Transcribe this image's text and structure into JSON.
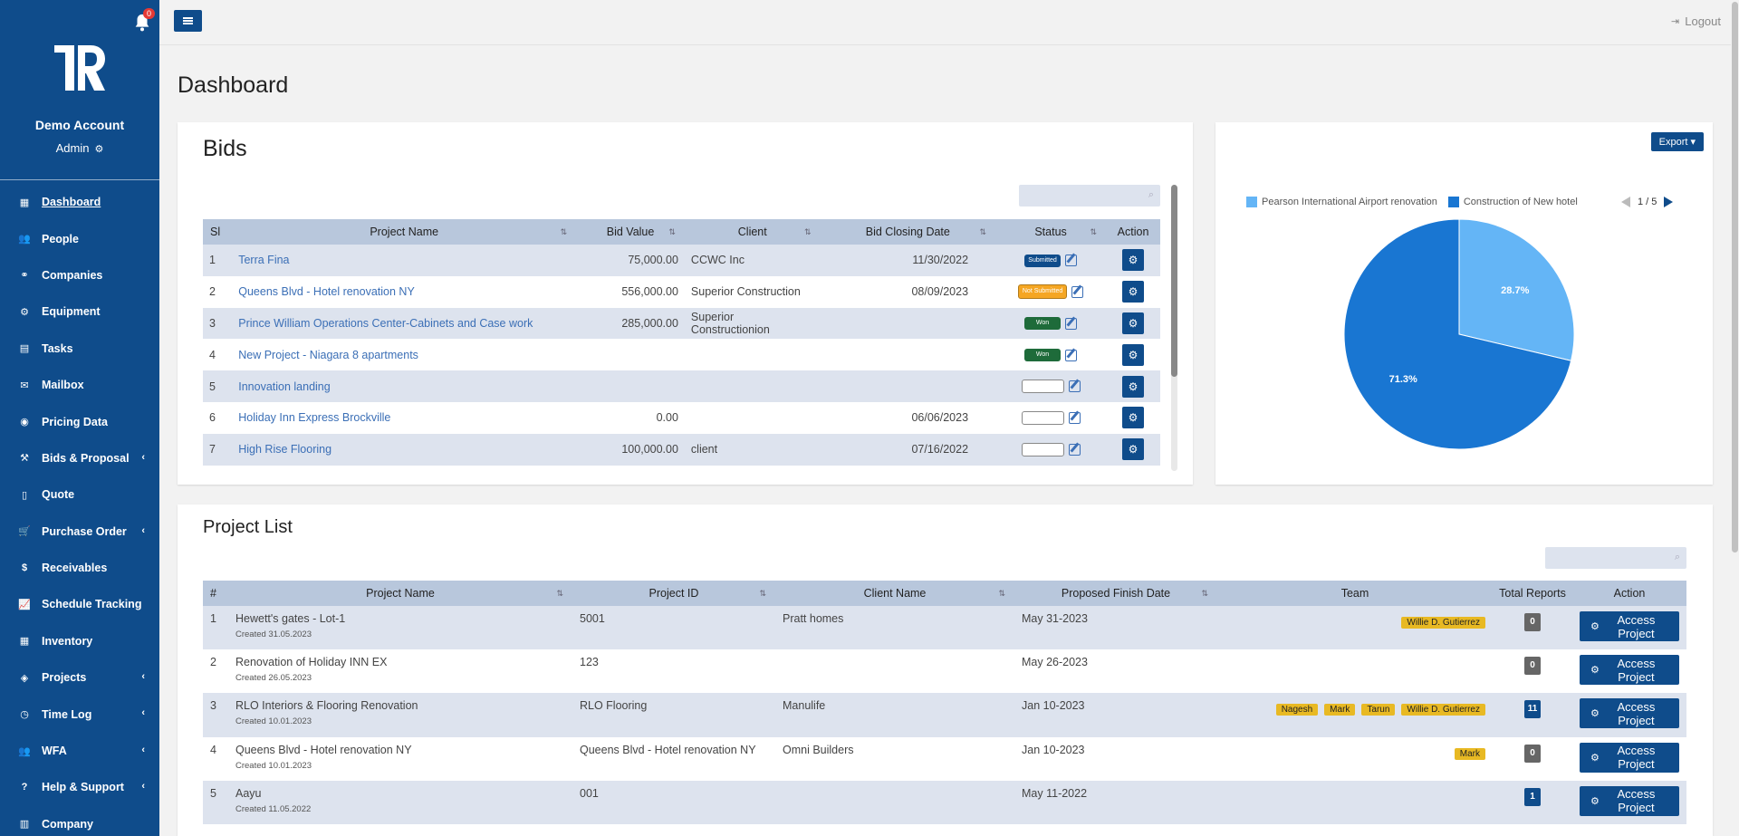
{
  "sidebar": {
    "notification_count": "0",
    "account_name": "Demo Account",
    "account_role": "Admin",
    "items": [
      {
        "label": "Dashboard",
        "icon": "dashboard-icon",
        "glyph": "▦",
        "chevron": false
      },
      {
        "label": "People",
        "icon": "users-icon",
        "glyph": "👥",
        "chevron": false
      },
      {
        "label": "Companies",
        "icon": "handshake-icon",
        "glyph": "⚭",
        "chevron": false
      },
      {
        "label": "Equipment",
        "icon": "gear-icon",
        "glyph": "⚙",
        "chevron": false
      },
      {
        "label": "Tasks",
        "icon": "tasks-icon",
        "glyph": "▤",
        "chevron": false
      },
      {
        "label": "Mailbox",
        "icon": "envelope-icon",
        "glyph": "✉",
        "chevron": false
      },
      {
        "label": "Pricing Data",
        "icon": "database-icon",
        "glyph": "◉",
        "chevron": false
      },
      {
        "label": "Bids & Proposal",
        "icon": "gavel-icon",
        "glyph": "⚒",
        "chevron": true
      },
      {
        "label": "Quote",
        "icon": "file-icon",
        "glyph": "▯",
        "chevron": false
      },
      {
        "label": "Purchase Order",
        "icon": "cart-icon",
        "glyph": "🛒",
        "chevron": true
      },
      {
        "label": "Receivables",
        "icon": "dollar-icon",
        "glyph": "$",
        "chevron": false
      },
      {
        "label": "Schedule Tracking",
        "icon": "line-chart-icon",
        "glyph": "📈",
        "chevron": false
      },
      {
        "label": "Inventory",
        "icon": "inventory-icon",
        "glyph": "▦",
        "chevron": false
      },
      {
        "label": "Projects",
        "icon": "diamond-icon",
        "glyph": "◈",
        "chevron": true
      },
      {
        "label": "Time Log",
        "icon": "clock-icon",
        "glyph": "◷",
        "chevron": true
      },
      {
        "label": "WFA",
        "icon": "group-icon",
        "glyph": "👥",
        "chevron": true
      },
      {
        "label": "Help & Support",
        "icon": "question-icon",
        "glyph": "?",
        "chevron": true
      },
      {
        "label": "Company",
        "icon": "building-icon",
        "glyph": "▥",
        "chevron": false
      }
    ]
  },
  "topbar": {
    "logout_label": "Logout"
  },
  "page": {
    "title": "Dashboard"
  },
  "bids": {
    "title": "Bids",
    "columns": [
      "Sl",
      "Project Name",
      "Bid Value",
      "Client",
      "Bid Closing Date",
      "Status",
      "Action"
    ],
    "rows": [
      {
        "sl": "1",
        "name": "Terra Fina",
        "value": "75,000.00",
        "client": "CCWC Inc",
        "date": "11/30/2022",
        "status": "Submitted",
        "status_type": "submitted"
      },
      {
        "sl": "2",
        "name": "Queens Blvd - Hotel renovation NY",
        "value": "556,000.00",
        "client": "Superior Construction",
        "date": "08/09/2023",
        "status": "Not Submitted",
        "status_type": "not"
      },
      {
        "sl": "3",
        "name": "Prince William Operations Center-Cabinets and Case work",
        "value": "285,000.00",
        "client": "Superior Constructionion",
        "date": "",
        "status": "Won",
        "status_type": "won"
      },
      {
        "sl": "4",
        "name": "New Project - Niagara 8 apartments",
        "value": "",
        "client": "",
        "date": "",
        "status": "Won",
        "status_type": "won"
      },
      {
        "sl": "5",
        "name": "Innovation landing",
        "value": "",
        "client": "",
        "date": "",
        "status": "",
        "status_type": "empty"
      },
      {
        "sl": "6",
        "name": "Holiday Inn Express Brockville",
        "value": "0.00",
        "client": "",
        "date": "06/06/2023",
        "status": "",
        "status_type": "empty"
      },
      {
        "sl": "7",
        "name": "High Rise Flooring",
        "value": "100,000.00",
        "client": "client",
        "date": "07/16/2022",
        "status": "",
        "status_type": "empty"
      }
    ]
  },
  "chart": {
    "export_label": "Export",
    "pager": "1 / 5"
  },
  "chart_data": {
    "type": "pie",
    "series": [
      {
        "name": "Pearson International Airport renovation",
        "value": 28.7,
        "label": "28.7%",
        "color": "#64b5f6"
      },
      {
        "name": "Construction of New hotel",
        "value": 71.3,
        "label": "71.3%",
        "color": "#1976d2"
      }
    ],
    "legend_position": "top-left"
  },
  "projects": {
    "title": "Project List",
    "columns": [
      "#",
      "Project Name",
      "Project ID",
      "Client Name",
      "Proposed Finish Date",
      "Team",
      "Total Reports",
      "Action"
    ],
    "access_label": "Access Project",
    "rows": [
      {
        "n": "1",
        "name": "Hewett's gates - Lot-1",
        "created": "Created 31.05.2023",
        "pid": "5001",
        "client": "Pratt homes",
        "date": "May 31-2023",
        "team": [
          "Willie D. Gutierrez"
        ],
        "reports": "0",
        "rep_type": "grey"
      },
      {
        "n": "2",
        "name": "Renovation of Holiday INN EX",
        "created": "Created 26.05.2023",
        "pid": "123",
        "client": "",
        "date": "May 26-2023",
        "team": [],
        "reports": "0",
        "rep_type": "grey"
      },
      {
        "n": "3",
        "name": "RLO Interiors & Flooring Renovation",
        "created": "Created 10.01.2023",
        "pid": "RLO Flooring",
        "client": "Manulife",
        "date": "Jan 10-2023",
        "team": [
          "Nagesh",
          "Mark",
          "Tarun",
          "Willie D. Gutierrez"
        ],
        "reports": "11",
        "rep_type": "blue"
      },
      {
        "n": "4",
        "name": "Queens Blvd - Hotel renovation NY",
        "created": "Created 10.01.2023",
        "pid": "Queens Blvd - Hotel renovation NY",
        "client": "Omni Builders",
        "date": "Jan 10-2023",
        "team": [
          "Mark"
        ],
        "reports": "0",
        "rep_type": "grey"
      },
      {
        "n": "5",
        "name": "Aayu",
        "created": "Created 11.05.2022",
        "pid": "001",
        "client": "",
        "date": "May 11-2022",
        "team": [],
        "reports": "1",
        "rep_type": "blue"
      }
    ]
  }
}
